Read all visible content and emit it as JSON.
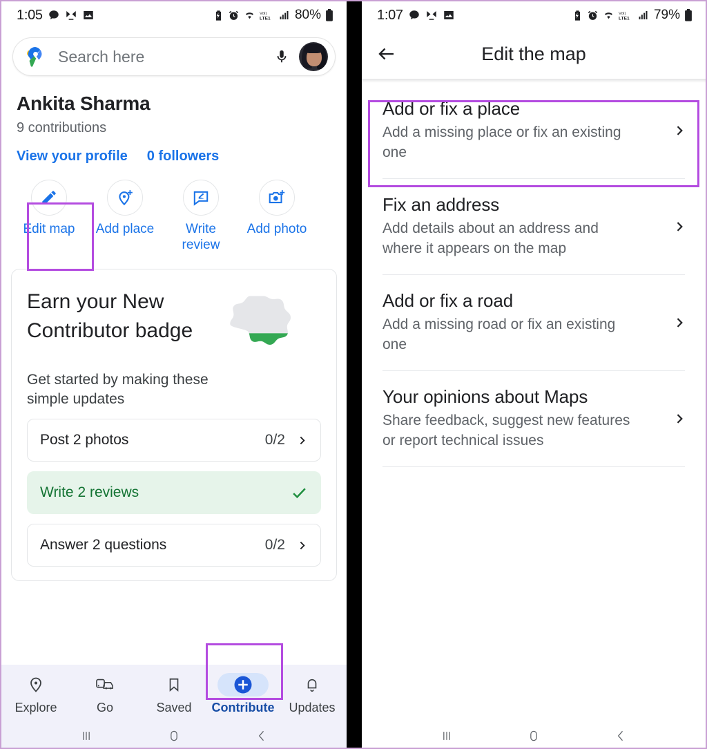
{
  "left_phone": {
    "status_bar": {
      "time": "1:05",
      "battery_percent": "80%",
      "icons": [
        "message-icon",
        "contact-missed-icon",
        "image-icon",
        "battery-saver-icon",
        "alarm-icon",
        "wifi-icon",
        "volte-icon",
        "signal-icon",
        "battery-icon"
      ]
    },
    "search": {
      "placeholder": "Search here",
      "logo": "google-maps-pin-logo",
      "mic": "microphone-icon",
      "avatar": "user-avatar"
    },
    "profile": {
      "name": "Ankita Sharma",
      "contributions": "9 contributions",
      "view_profile_label": "View your profile",
      "followers_label": "0 followers"
    },
    "actions": [
      {
        "label": "Edit map",
        "icon": "pencil-icon",
        "highlighted": true
      },
      {
        "label": "Add place",
        "icon": "add-place-pin-icon",
        "highlighted": false
      },
      {
        "label": "Write review",
        "icon": "review-bubble-icon",
        "highlighted": false
      },
      {
        "label": "Add photo",
        "icon": "add-photo-camera-icon",
        "highlighted": false
      }
    ],
    "badge_card": {
      "title": "Earn your New Contributor badge",
      "subtitle": "Get started by making these simple updates",
      "art": "contributor-badge-art",
      "tasks": [
        {
          "label": "Post 2 photos",
          "count": "0/2",
          "done": false
        },
        {
          "label": "Write 2 reviews",
          "count": "",
          "done": true
        },
        {
          "label": "Answer 2 questions",
          "count": "0/2",
          "done": false
        }
      ]
    },
    "bottom_nav": [
      {
        "label": "Explore",
        "icon": "location-pin-icon",
        "active": false
      },
      {
        "label": "Go",
        "icon": "commute-icon",
        "active": false
      },
      {
        "label": "Saved",
        "icon": "bookmark-icon",
        "active": false
      },
      {
        "label": "Contribute",
        "icon": "plus-circle-icon",
        "active": true
      },
      {
        "label": "Updates",
        "icon": "bell-icon",
        "active": false
      }
    ],
    "system_nav": [
      "recents-icon",
      "home-icon",
      "back-icon"
    ]
  },
  "right_phone": {
    "status_bar": {
      "time": "1:07",
      "battery_percent": "79%"
    },
    "app_bar": {
      "back_icon": "arrow-back-icon",
      "title": "Edit the map"
    },
    "edit_items": [
      {
        "title": "Add or fix a place",
        "subtitle": "Add a missing place or fix an existing one",
        "chevron": "chevron-right-icon",
        "highlighted": true
      },
      {
        "title": "Fix an address",
        "subtitle": "Add details about an address and where it appears on the map",
        "chevron": "chevron-right-icon",
        "highlighted": false
      },
      {
        "title": "Add or fix a road",
        "subtitle": "Add a missing road or fix an existing one",
        "chevron": "chevron-right-icon",
        "highlighted": false
      },
      {
        "title": "Your opinions about Maps",
        "subtitle": "Share feedback, suggest new features or report technical issues",
        "chevron": "chevron-right-icon",
        "highlighted": false
      }
    ],
    "system_nav": [
      "recents-icon",
      "home-icon",
      "back-icon"
    ]
  },
  "colors": {
    "highlight_box": "#b44ce0",
    "link_blue": "#1a73e8",
    "active_nav_blue": "#174ea6",
    "done_green": "#137333",
    "done_bg": "#e6f4ea",
    "badge_green": "#34a853",
    "nav_bg": "#f1f1fa"
  }
}
